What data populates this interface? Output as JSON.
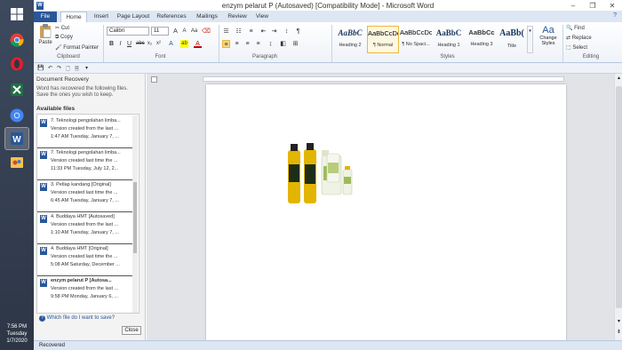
{
  "taskbar": {
    "apps": [
      {
        "name": "start-button",
        "icon": "windows-logo-icon"
      },
      {
        "name": "chrome-app",
        "icon": "chrome-icon"
      },
      {
        "name": "opera-app",
        "icon": "opera-icon"
      },
      {
        "name": "excel-app",
        "icon": "excel-icon"
      },
      {
        "name": "chrome-app-2",
        "icon": "chrome-icon"
      },
      {
        "name": "word-app",
        "icon": "word-icon"
      },
      {
        "name": "paint-app",
        "icon": "paint-icon"
      }
    ],
    "time": "7:56 PM",
    "day": "Tuesday",
    "date": "1/7/2020"
  },
  "window": {
    "title": "enzym pelarut P (Autosaved) [Compatibility Mode]  -  Microsoft Word",
    "minimize": "–",
    "maximize": "❐",
    "close": "✕"
  },
  "tabs": [
    "File",
    "Home",
    "Insert",
    "Page Layout",
    "References",
    "Mailings",
    "Review",
    "View"
  ],
  "ribbon": {
    "clipboard": {
      "paste": "Paste",
      "cut": "Cut",
      "copy": "Copy",
      "format_painter": "Format Painter",
      "label": "Clipboard"
    },
    "font": {
      "name": "Calibri",
      "size": "11",
      "label": "Font"
    },
    "paragraph": {
      "label": "Paragraph"
    },
    "styles": {
      "items": [
        {
          "sample": "AaBbC",
          "name": "Heading 2"
        },
        {
          "sample": "AaBbCcDc",
          "name": "¶ Normal"
        },
        {
          "sample": "AaBbCcDc",
          "name": "¶ No Spaci..."
        },
        {
          "sample": "AaBbC",
          "name": "Heading 1"
        },
        {
          "sample": "AaBbCc",
          "name": "Heading 3"
        },
        {
          "sample": "AaBb(",
          "name": "Title"
        }
      ],
      "selected_index": 1,
      "change_styles": "Change Styles",
      "label": "Styles"
    },
    "editing": {
      "find": "Find",
      "replace": "Replace",
      "select": "Select",
      "label": "Editing"
    }
  },
  "recovery": {
    "title": "Document Recovery",
    "message": "Word has recovered the following files.  Save the ones you wish to keep.",
    "available": "Available files",
    "files": [
      {
        "name": "7. Teknologi pengolahan limba...",
        "status": "Version created from the last ...",
        "time": "1:47 AM Tuesday, January 7, ..."
      },
      {
        "name": "7. Teknologi pengolahan limba...",
        "status": "Version created last time the ...",
        "time": "11:33 PM Tuesday, July 12, 2..."
      },
      {
        "name": "3. Petlap kandang  [Original]",
        "status": "Version created last time the ...",
        "time": "6:45 AM Tuesday, January 7, ..."
      },
      {
        "name": "4. Buddaya HMT  [Autosaved]",
        "status": "Version created from the last ...",
        "time": "1:10 AM Tuesday, January 7, ..."
      },
      {
        "name": "4. Buddaya HMT  [Original]",
        "status": "Version created last time the ...",
        "time": "5:08 AM Saturday, December ..."
      },
      {
        "name": "enzym pelarut P  [Autosa...",
        "status": "Version created from the last ...",
        "time": "9:58 PM Monday, January 6, ..."
      }
    ],
    "question": "Which file do I want to save?",
    "close": "Close"
  },
  "status": {
    "text": "Recovered"
  },
  "colors": {
    "word_blue": "#2a5699",
    "ribbon_bg": "#eef2f8",
    "style_selected": "#e7b844"
  }
}
